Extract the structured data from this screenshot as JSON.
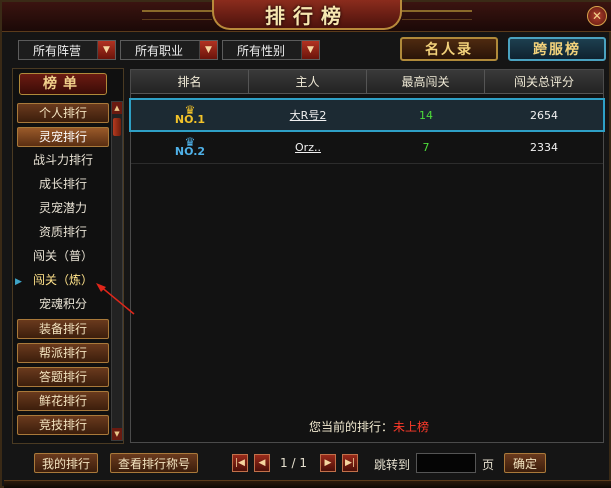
{
  "window": {
    "title": "排行榜",
    "close_glyph": "✕"
  },
  "filters": [
    {
      "label": "所有阵营"
    },
    {
      "label": "所有职业"
    },
    {
      "label": "所有性别"
    }
  ],
  "top_buttons": {
    "famous": "名人录",
    "cross_server": "跨服榜"
  },
  "sidebar": {
    "header": "榜单",
    "items": [
      {
        "label": "个人排行",
        "kind": "button"
      },
      {
        "label": "灵宠排行",
        "kind": "button",
        "active": true
      },
      {
        "label": "战斗力排行",
        "kind": "sub"
      },
      {
        "label": "成长排行",
        "kind": "sub"
      },
      {
        "label": "灵宠潜力",
        "kind": "sub"
      },
      {
        "label": "资质排行",
        "kind": "sub"
      },
      {
        "label": "闯关（普）",
        "kind": "sub"
      },
      {
        "label": "闯关（炼）",
        "kind": "sub",
        "selected": true
      },
      {
        "label": "宠魂积分",
        "kind": "sub"
      },
      {
        "label": "装备排行",
        "kind": "button"
      },
      {
        "label": "帮派排行",
        "kind": "button"
      },
      {
        "label": "答题排行",
        "kind": "button"
      },
      {
        "label": "鲜花排行",
        "kind": "button"
      },
      {
        "label": "竞技排行",
        "kind": "button"
      }
    ]
  },
  "table": {
    "columns": [
      "排名",
      "主人",
      "最高闯关",
      "闯关总评分"
    ],
    "rows": [
      {
        "rank": "NO.1",
        "owner": "大R号2",
        "best_stage": "14",
        "total_score": "2654",
        "crown_color": "#f3c32a"
      },
      {
        "rank": "NO.2",
        "owner": "Orz..",
        "best_stage": "7",
        "total_score": "2334",
        "crown_color": "#4fb1e8"
      }
    ]
  },
  "my_rank": {
    "label": "您当前的排行：",
    "value": "未上榜"
  },
  "bottom": {
    "my_rank_button": "我的排行",
    "view_titles_button": "查看排行称号",
    "page_current": "1",
    "page_sep": "/",
    "page_total": "1",
    "jump_label": "跳转到",
    "jump_value": "",
    "page_unit": "页",
    "confirm": "确定"
  },
  "colors": {
    "accent_gold": "#f3d27b",
    "highlight_cyan": "#2ea0c6",
    "green_value": "#4ddc3a",
    "red_status": "#ff3a2a"
  }
}
